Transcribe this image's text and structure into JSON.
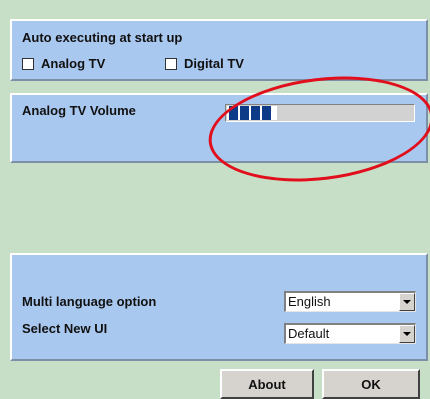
{
  "auto_exec": {
    "title": "Auto executing at start up",
    "options": [
      {
        "label": "Analog TV",
        "checked": false
      },
      {
        "label": "Digital TV",
        "checked": false
      }
    ]
  },
  "volume": {
    "label": "Analog TV Volume",
    "level_blocks": 4
  },
  "settings": {
    "language_label": "Multi language option",
    "language_value": "English",
    "ui_label": "Select New UI",
    "ui_value": "Default"
  },
  "buttons": {
    "about": "About",
    "ok": "OK"
  },
  "colors": {
    "background": "#c6dfc6",
    "panel": "#a9c8ef",
    "volume_block": "#0d3b87",
    "highlight_ellipse": "#e10e1c"
  }
}
